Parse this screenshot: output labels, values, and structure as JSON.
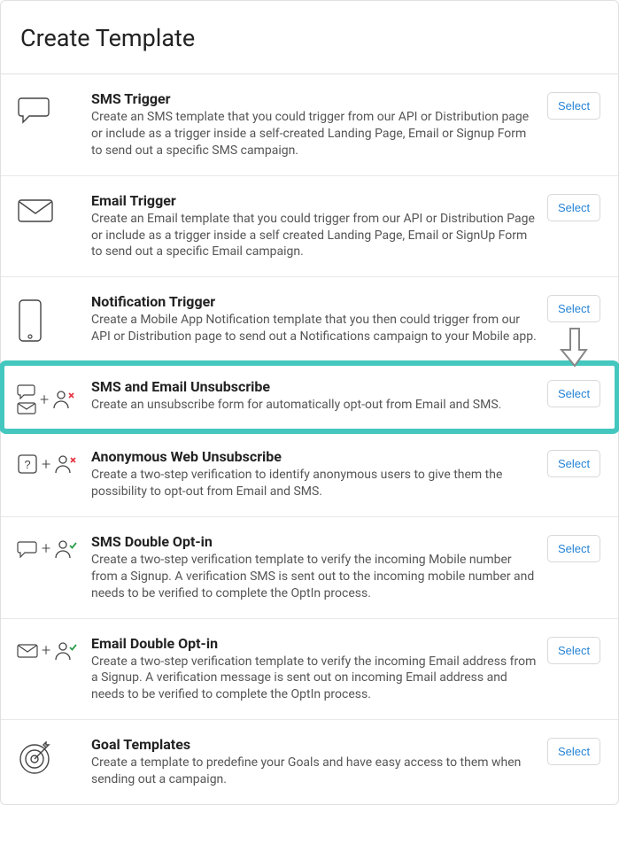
{
  "header": {
    "title": "Create Template"
  },
  "select_label": "Select",
  "rows": [
    {
      "id": "sms-trigger",
      "title": "SMS Trigger",
      "desc": "Create an SMS template that you could trigger from our API or Distribution page or include as a trigger inside a self-created Landing Page, Email or Signup Form to send out a specific SMS campaign."
    },
    {
      "id": "email-trigger",
      "title": "Email Trigger",
      "desc": "Create an Email template that you could trigger from our API or Distribution Page or include as a trigger inside a self created Landing Page, Email or SignUp Form to send out a specific Email campaign."
    },
    {
      "id": "notification-trigger",
      "title": "Notification Trigger",
      "desc": "Create a Mobile App Notification template that you then could trigger from our API or Distribution page to send out a Notifications campaign to your Mobile app."
    },
    {
      "id": "sms-email-unsubscribe",
      "title": "SMS and Email Unsubscribe",
      "desc": "Create an unsubscribe form for automatically opt-out from Email and SMS."
    },
    {
      "id": "anonymous-unsubscribe",
      "title": "Anonymous Web Unsubscribe",
      "desc": "Create a two-step verification to identify anonymous users to give them the possibility to opt-out from Email and SMS."
    },
    {
      "id": "sms-double-optin",
      "title": "SMS Double Opt-in",
      "desc": "Create a two-step verification template to verify the incoming Mobile number from a Signup. A verification SMS is sent out to the incoming mobile number and needs to be verified to complete the OptIn process."
    },
    {
      "id": "email-double-optin",
      "title": "Email Double Opt-in",
      "desc": "Create a two-step verification template to verify the incoming Email address from a Signup. A verification message is sent out on incoming Email address and needs to be verified to complete the OptIn process."
    },
    {
      "id": "goal-templates",
      "title": "Goal Templates",
      "desc": "Create a template to predefine your Goals and have easy access to them when sending out a campaign."
    }
  ]
}
